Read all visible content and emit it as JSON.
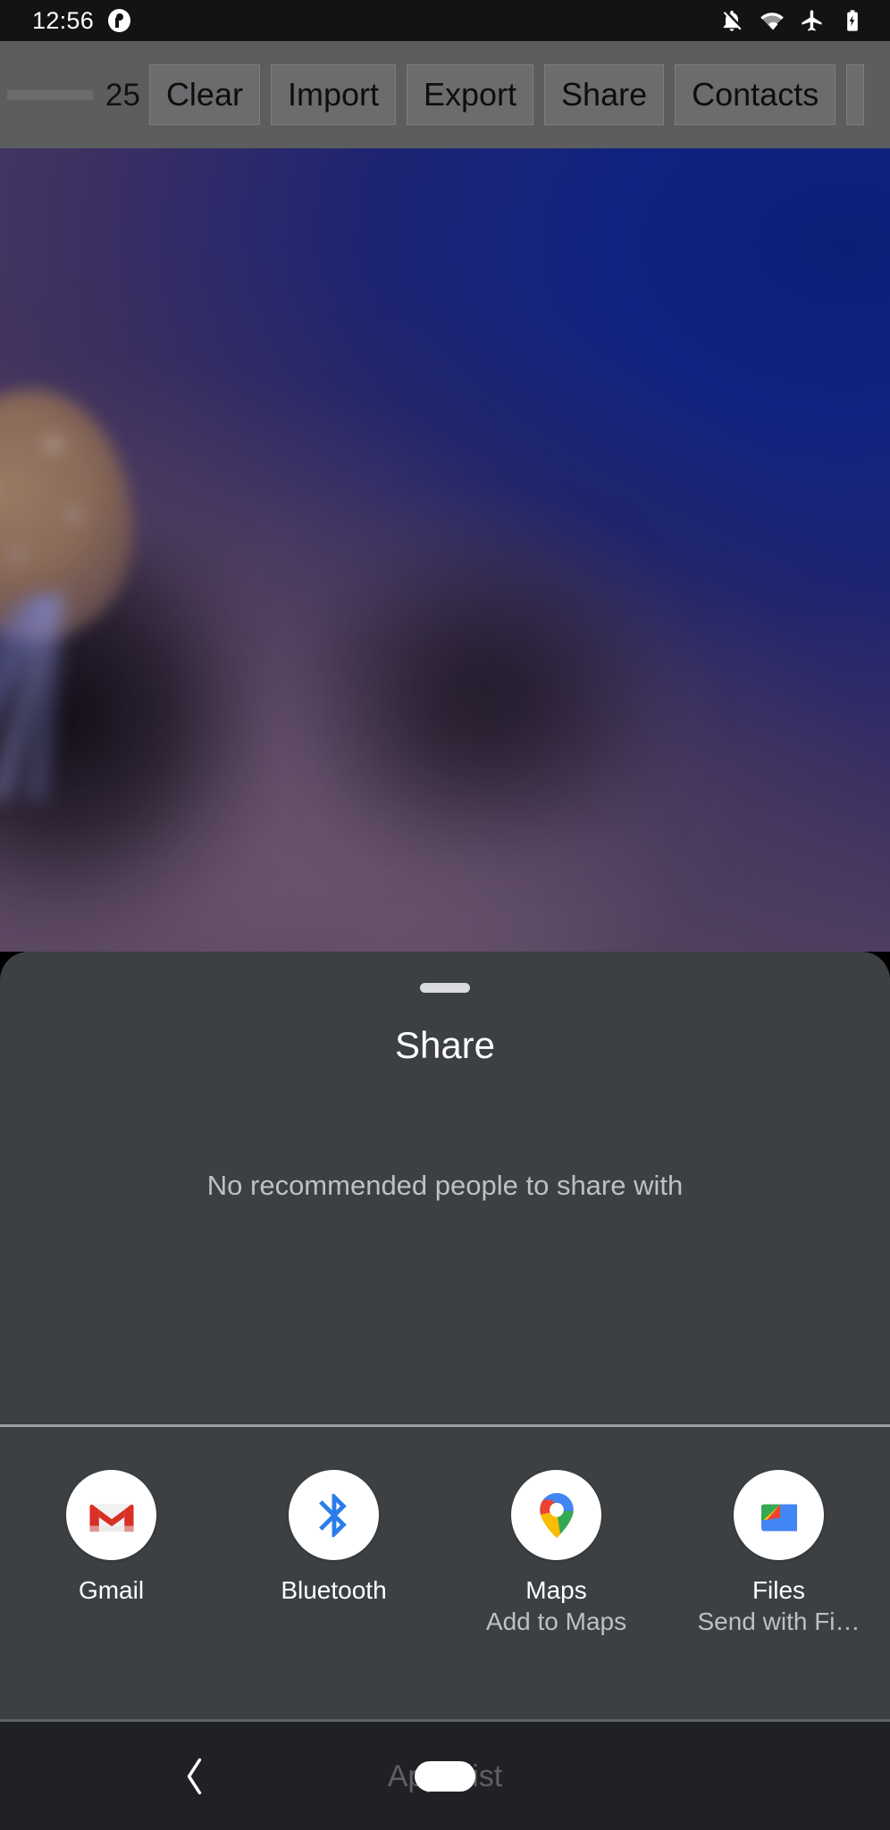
{
  "status_bar": {
    "time": "12:56",
    "app_icon": "app-notification-icon",
    "icons": [
      {
        "name": "notifications-off-icon",
        "label": "Notifications silenced"
      },
      {
        "name": "wifi-icon",
        "label": "Wi-Fi connected"
      },
      {
        "name": "airplane-mode-icon",
        "label": "Airplane mode on"
      },
      {
        "name": "battery-charging-icon",
        "label": "Battery charging"
      }
    ]
  },
  "toolbar": {
    "count": "25",
    "buttons": [
      {
        "label": "Clear"
      },
      {
        "label": "Import"
      },
      {
        "label": "Export"
      },
      {
        "label": "Share"
      },
      {
        "label": "Contacts"
      }
    ]
  },
  "share_sheet": {
    "title": "Share",
    "empty_people_message": "No recommended people to share with",
    "drag_handle": "drag-handle",
    "apps": [
      {
        "label": "Gmail",
        "subtitle": "",
        "icon": "gmail-icon"
      },
      {
        "label": "Bluetooth",
        "subtitle": "",
        "icon": "bluetooth-icon"
      },
      {
        "label": "Maps",
        "subtitle": "Add to Maps",
        "icon": "google-maps-icon"
      },
      {
        "label": "Files",
        "subtitle": "Send with Fi…",
        "icon": "google-files-icon"
      }
    ]
  },
  "nav_bar": {
    "back_icon": "back-chevron-icon",
    "hint": "Apps list",
    "gesture_pill": "home-gesture-pill"
  },
  "colors": {
    "sheet_background": "#3c4043",
    "nav_background": "#202124",
    "status_background": "#131314",
    "toolbar_background": "#5b5d5f",
    "primary_text": "#ffffff",
    "secondary_text": "#bdc1c6",
    "divider": "#9aa0a6",
    "gmail_red": "#d93025",
    "bluetooth_blue": "#2b7de9",
    "maps_blue": "#4285f4",
    "maps_red": "#ea4335",
    "maps_yellow": "#fbbc04",
    "maps_green": "#34a853"
  }
}
